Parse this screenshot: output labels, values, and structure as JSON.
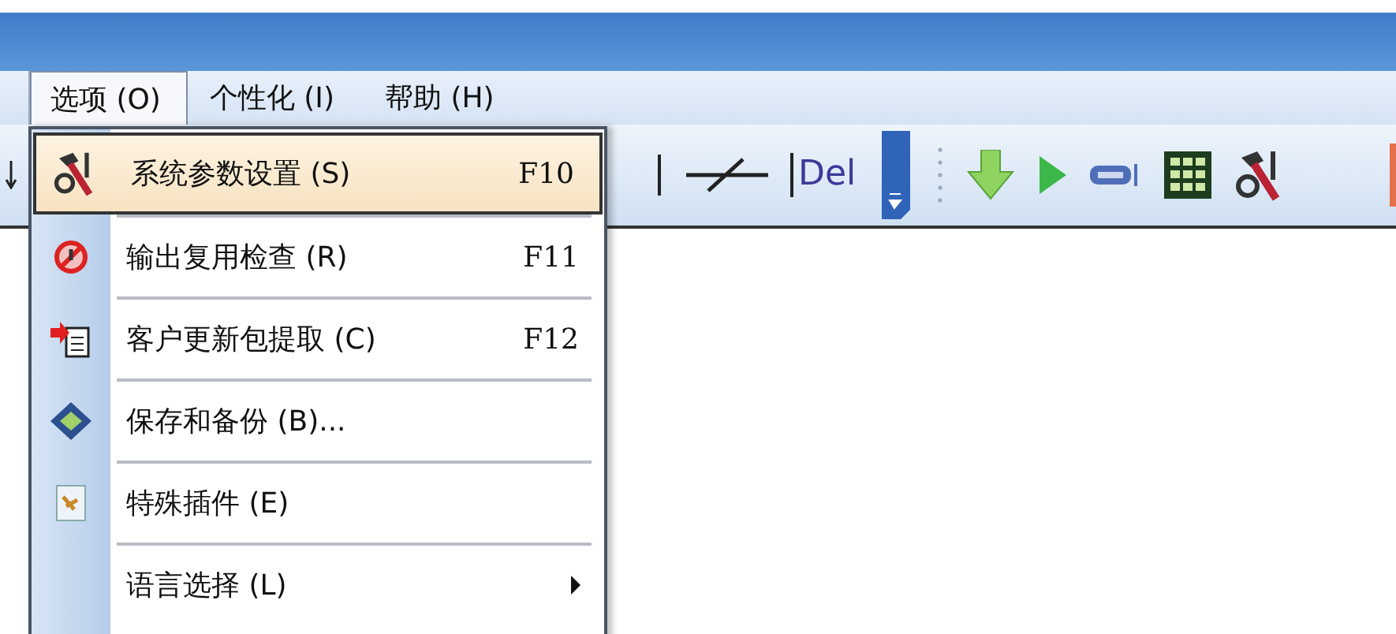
{
  "menubar": [
    {
      "label": "选项 (O)",
      "selected": true
    },
    {
      "label": "个性化 (I)",
      "selected": false
    },
    {
      "label": "帮助 (H)",
      "selected": false
    }
  ],
  "toolbar": [
    {
      "kind": "bar"
    },
    {
      "kind": "contact"
    },
    {
      "kind": "text",
      "label": "Del"
    },
    {
      "kind": "handle"
    },
    {
      "kind": "grip"
    },
    {
      "kind": "download"
    },
    {
      "kind": "play"
    },
    {
      "kind": "port"
    },
    {
      "kind": "grid"
    },
    {
      "kind": "tools"
    }
  ],
  "menu": [
    {
      "kind": "tools",
      "label": "系统参数设置 (S)",
      "shortcut": "F10",
      "selected": true,
      "submenu": false
    },
    {
      "kind": "stop",
      "label": "输出复用检查 (R)",
      "shortcut": "F11",
      "selected": false,
      "submenu": false
    },
    {
      "kind": "import",
      "label": "客户更新包提取 (C)",
      "shortcut": "F12",
      "selected": false,
      "submenu": false
    },
    {
      "kind": "disk",
      "label": "保存和备份 (B)...",
      "selected": false,
      "submenu": false
    },
    {
      "kind": "plugin",
      "label": "特殊插件 (E)",
      "selected": false,
      "submenu": false
    },
    {
      "kind": "plain",
      "label": "语言选择 (L)",
      "selected": false,
      "submenu": true
    }
  ]
}
